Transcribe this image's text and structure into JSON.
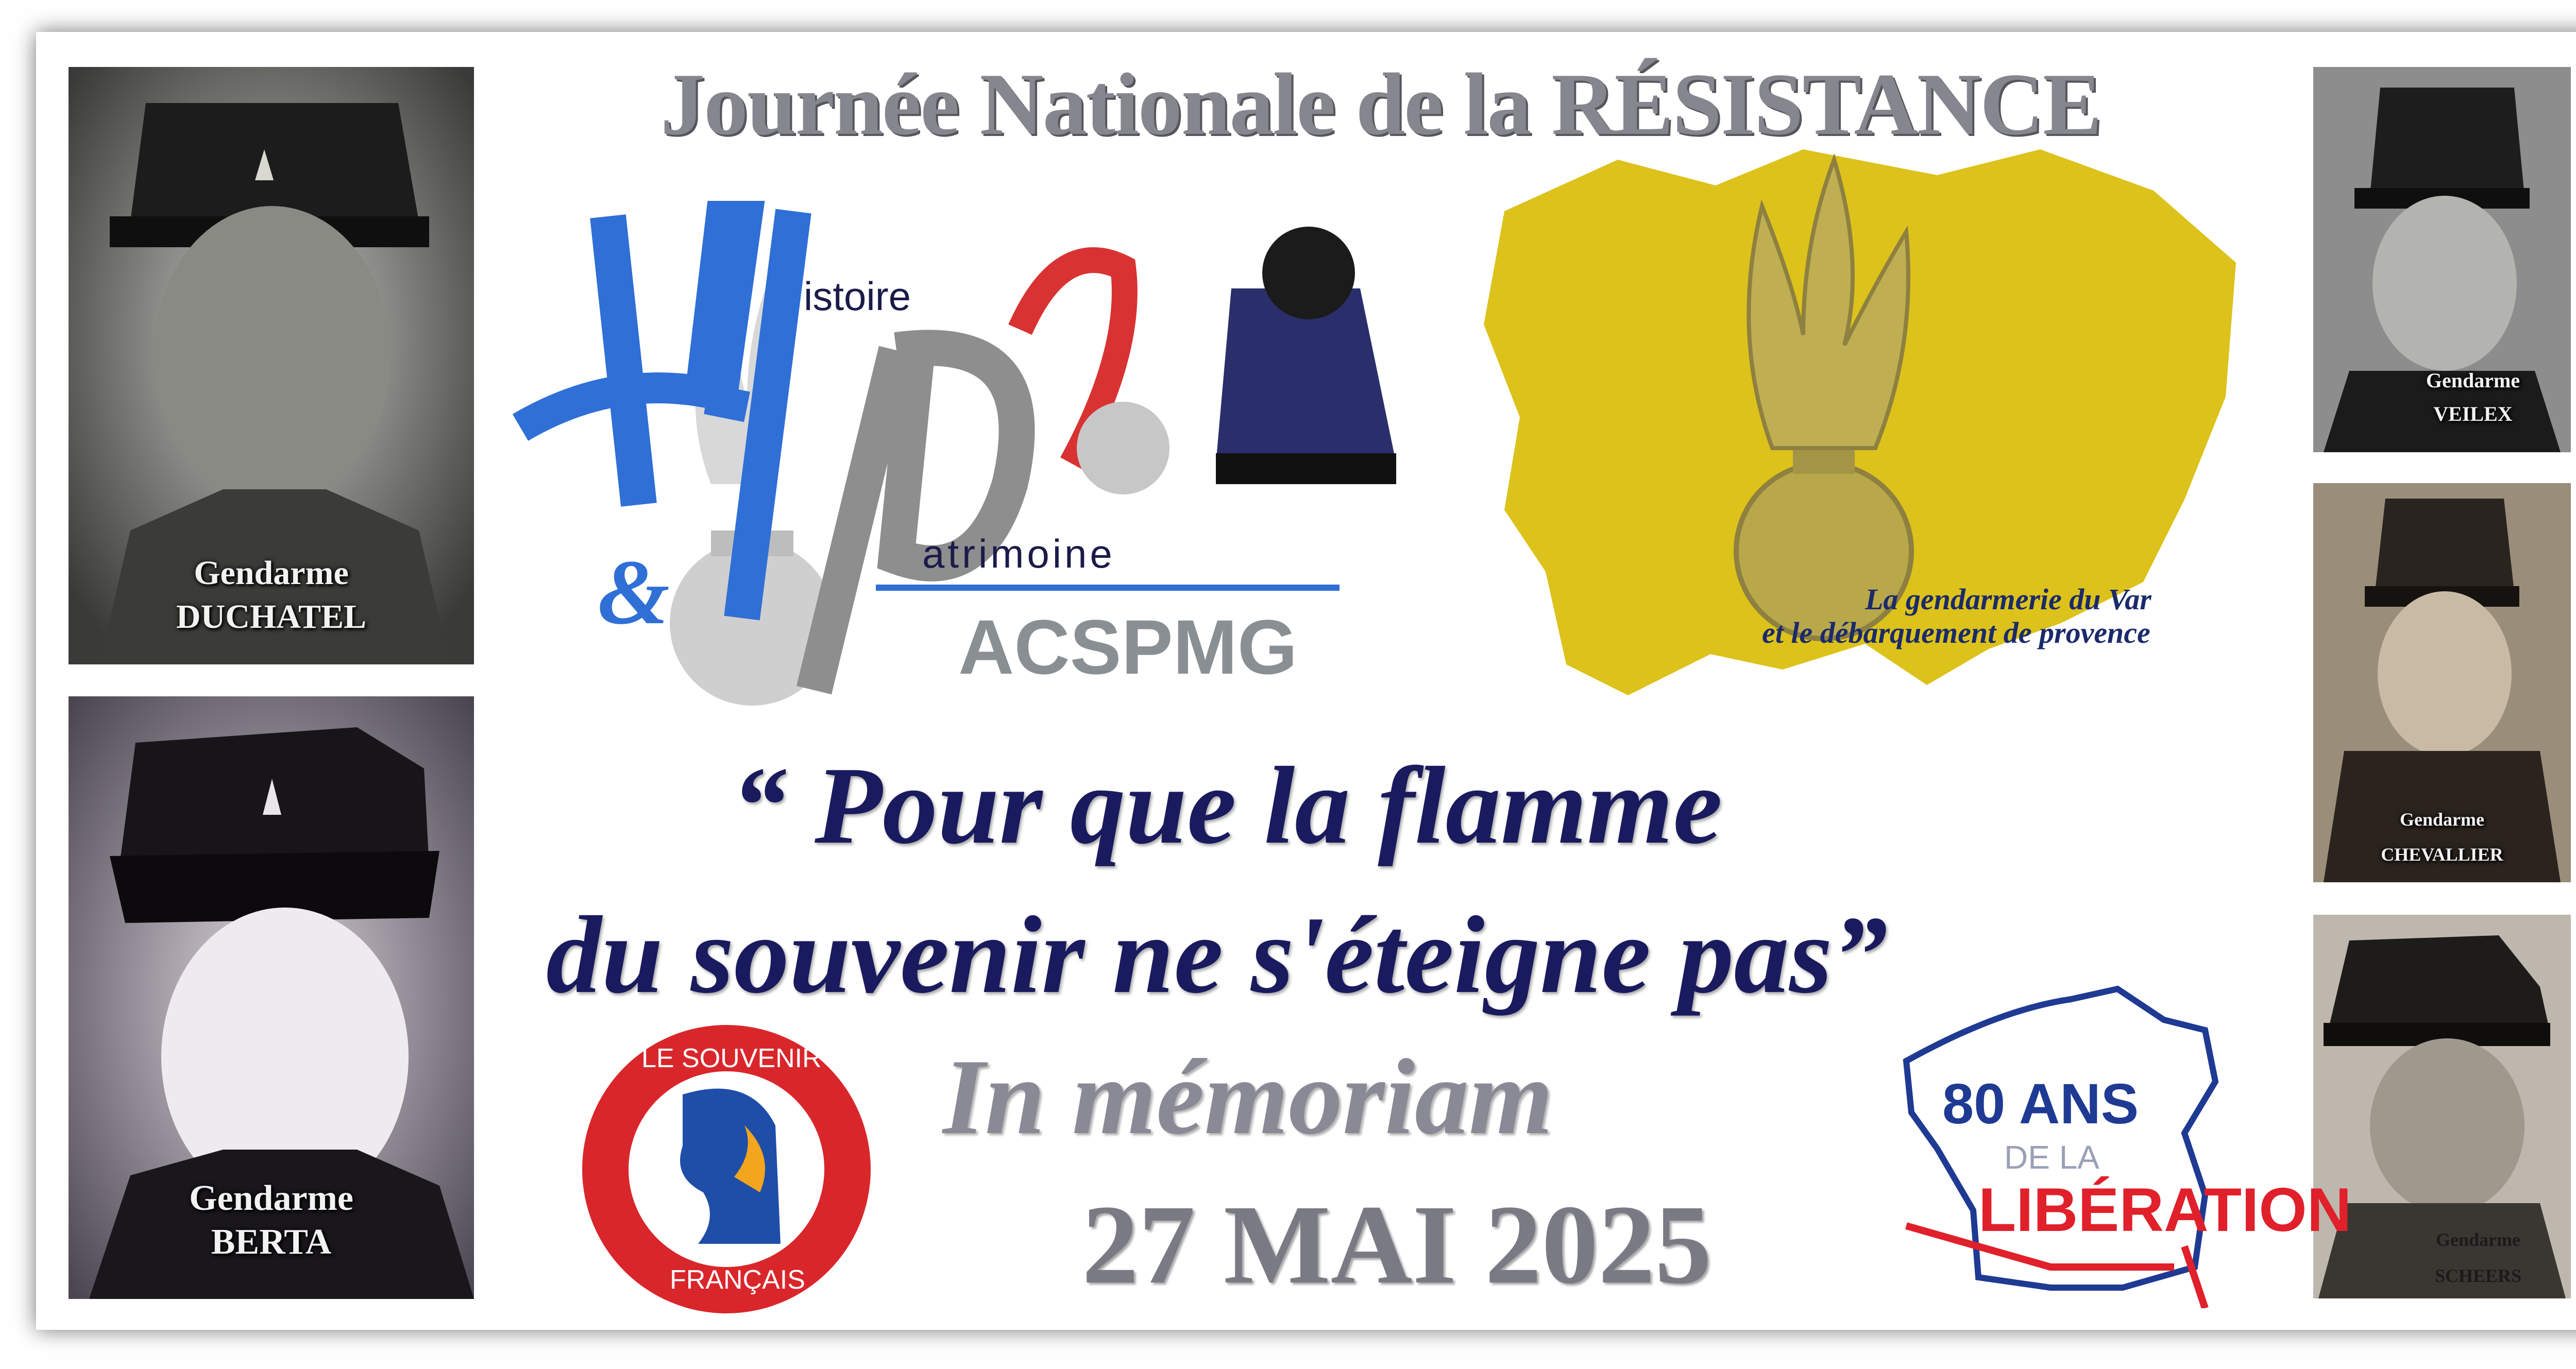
{
  "title": "Journée Nationale de la RÉSISTANCE",
  "quote": {
    "line1": "“ Pour que la flamme",
    "line2": "du souvenir ne s'éteigne pas”"
  },
  "memoriam": "In mémoriam",
  "date": "27 MAI 2025",
  "logo_hp": {
    "histoire": "istoire",
    "patrimoine": "atrimoine",
    "acronym": "ACSPMG"
  },
  "map_caption": {
    "line1": "La gendarmerie du Var",
    "line2": "et le débarquement de provence"
  },
  "souvenir_logo": {
    "top": "LE SOUVENIR",
    "bottom": "FRANÇAIS"
  },
  "liberation_logo": {
    "number": "80 ANS",
    "middle": "DE LA",
    "word": "LIBÉRATION"
  },
  "portraits": [
    {
      "rank": "Gendarme",
      "name": "DUCHATEL"
    },
    {
      "rank": "Gendarme",
      "name": "BERTA"
    },
    {
      "rank": "Gendarme",
      "name": "VEILEX"
    },
    {
      "rank": "Gendarme",
      "name": "CHEVALLIER"
    },
    {
      "rank": "Gendarme",
      "name": "SCHEERS"
    }
  ],
  "colors": {
    "title_grey": "#86868f",
    "quote_navy": "#1a1a5e",
    "map_yellow": "#dcc21b",
    "hp_blue": "#2f6fd6",
    "souvenir_red": "#d9262b",
    "liberation_blue": "#1f3a93",
    "liberation_red": "#e0202a"
  }
}
